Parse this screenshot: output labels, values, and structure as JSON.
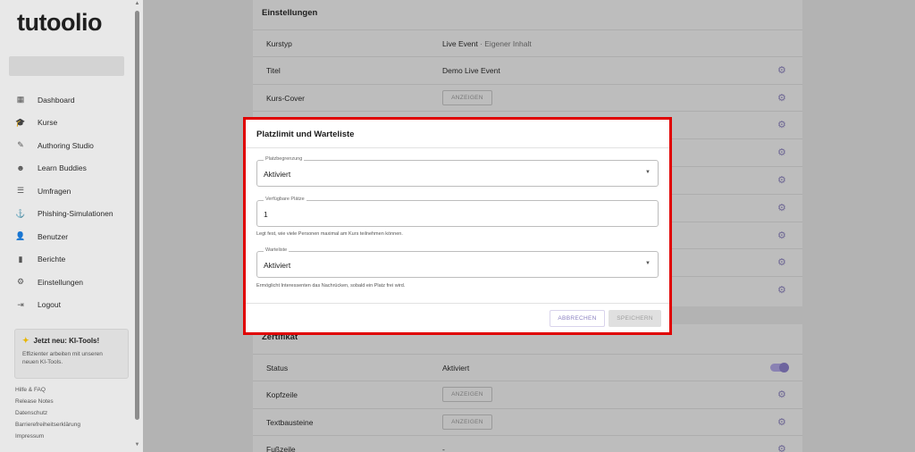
{
  "sidebar": {
    "logo": "tutoolio",
    "nav": [
      {
        "label": "Dashboard",
        "icon": "dashboard-icon",
        "glyph": "▦"
      },
      {
        "label": "Kurse",
        "icon": "graduation-cap-icon",
        "glyph": "🎓"
      },
      {
        "label": "Authoring Studio",
        "icon": "pencil-icon",
        "glyph": "✎"
      },
      {
        "label": "Learn Buddies",
        "icon": "buddies-icon",
        "glyph": "☻"
      },
      {
        "label": "Umfragen",
        "icon": "list-check-icon",
        "glyph": "☰"
      },
      {
        "label": "Phishing-Simulationen",
        "icon": "phishing-hook-icon",
        "glyph": "⚓"
      },
      {
        "label": "Benutzer",
        "icon": "user-icon",
        "glyph": "👤"
      },
      {
        "label": "Berichte",
        "icon": "bar-chart-icon",
        "glyph": "▮"
      },
      {
        "label": "Einstellungen",
        "icon": "gear-icon",
        "glyph": "⚙"
      },
      {
        "label": "Logout",
        "icon": "logout-icon",
        "glyph": "⇥"
      }
    ],
    "promo": {
      "title": "Jetzt neu: KI-Tools!",
      "text": "Effizienter arbeiten mit unseren neuen KI-Tools."
    },
    "footer_links": [
      "Hilfe & FAQ",
      "Release Notes",
      "Datenschutz",
      "Barrierefreiheitserklärung",
      "Impressum"
    ]
  },
  "settings": {
    "title": "Einstellungen",
    "rows": [
      {
        "label": "Kurstyp",
        "value": "Live Event",
        "muted": " · Eigener Inhalt"
      },
      {
        "label": "Titel",
        "value": "Demo Live Event"
      },
      {
        "label": "Kurs-Cover",
        "button": "ANZEIGEN"
      }
    ]
  },
  "certificate": {
    "title": "Zertifikat",
    "rows": [
      {
        "label": "Status",
        "value": "Aktiviert"
      },
      {
        "label": "Kopfzeile",
        "button": "ANZEIGEN"
      },
      {
        "label": "Textbausteine",
        "button": "ANZEIGEN"
      },
      {
        "label": "Fußzeile",
        "value": "-"
      }
    ]
  },
  "modal": {
    "title": "Platzlimit und Warteliste",
    "limit": {
      "legend": "Platzbegrenzung",
      "value": "Aktiviert"
    },
    "seats": {
      "legend": "Verfügbare Plätze",
      "value": "1",
      "helper": "Legt fest, wie viele Personen maximal am Kurs teilnehmen können."
    },
    "waitlist": {
      "legend": "Warteliste",
      "value": "Aktiviert",
      "helper": "Ermöglicht Interessenten das Nachrücken, sobald ein Platz frei wird."
    },
    "cancel": "ABBRECHEN",
    "save": "SPEICHERN"
  },
  "colors": {
    "accent": "#7b6fc0",
    "highlight_border": "#e00000"
  }
}
